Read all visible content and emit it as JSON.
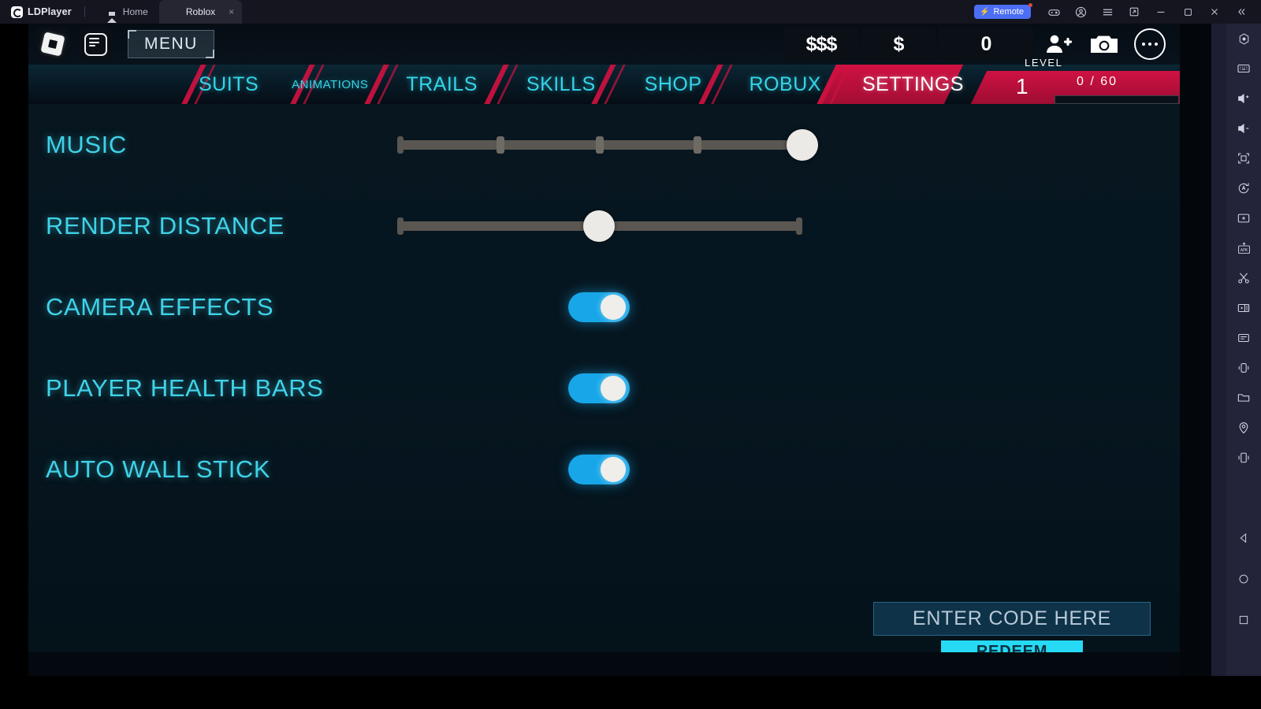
{
  "titlebar": {
    "app_name": "LDPlayer",
    "tabs": [
      {
        "label": "Home",
        "icon": "home-icon",
        "active": false
      },
      {
        "label": "Roblox",
        "icon": "roblox-icon",
        "active": true,
        "close": "×"
      }
    ],
    "remote_label": "Remote",
    "buttons": [
      {
        "name": "gamepad-icon"
      },
      {
        "name": "account-icon"
      },
      {
        "name": "hamburger-menu-icon"
      },
      {
        "name": "restore-down-icon"
      },
      {
        "name": "minimize-icon"
      },
      {
        "name": "maximize-icon"
      },
      {
        "name": "close-icon"
      },
      {
        "name": "collapse-icon"
      }
    ]
  },
  "hud": {
    "menu_label": "MENU",
    "currencies": [
      {
        "name": "premium-currency",
        "value": "$$$"
      },
      {
        "name": "cash-currency",
        "value": "$"
      },
      {
        "name": "coin-count",
        "value": "0"
      }
    ],
    "icons": [
      {
        "name": "add-friend-icon"
      },
      {
        "name": "camera-icon"
      },
      {
        "name": "more-options-icon"
      }
    ]
  },
  "nav": {
    "items": [
      {
        "label": "SUITS",
        "active": false,
        "small": false
      },
      {
        "label": "ANIMATIONS",
        "active": false,
        "small": true
      },
      {
        "label": "TRAILS",
        "active": false,
        "small": false
      },
      {
        "label": "SKILLS",
        "active": false,
        "small": false
      },
      {
        "label": "SHOP",
        "active": false,
        "small": false
      },
      {
        "label": "ROBUX",
        "active": false,
        "small": false
      },
      {
        "label": "SETTINGS",
        "active": true,
        "small": false
      }
    ]
  },
  "level": {
    "label": "LEVEL",
    "value": "1",
    "xp": "0 / 60",
    "xp_current": 0,
    "xp_max": 60
  },
  "settings": {
    "rows": [
      {
        "label": "MUSIC",
        "type": "slider",
        "value": 100,
        "ticks": [
          25,
          50,
          75
        ]
      },
      {
        "label": "RENDER DISTANCE",
        "type": "slider",
        "value": 50,
        "ticks": []
      },
      {
        "label": "CAMERA EFFECTS",
        "type": "toggle",
        "on": true
      },
      {
        "label": "PLAYER HEALTH BARS",
        "type": "toggle",
        "on": true
      },
      {
        "label": "AUTO WALL STICK",
        "type": "toggle",
        "on": true
      }
    ]
  },
  "code": {
    "input_value": "ENTER CODE HERE",
    "input_placeholder": "ENTER CODE HERE",
    "redeem_label": "REDEEM"
  },
  "rail": {
    "top_icons": [
      {
        "name": "settings-hex-icon"
      },
      {
        "name": "keyboard-icon"
      },
      {
        "name": "volume-up-icon"
      },
      {
        "name": "volume-down-icon"
      },
      {
        "name": "fullscreen-icon"
      },
      {
        "name": "auto-rotate-icon"
      },
      {
        "name": "multi-instance-icon"
      },
      {
        "name": "apk-install-icon"
      },
      {
        "name": "scissors-screenshot-icon"
      },
      {
        "name": "video-record-icon"
      },
      {
        "name": "macro-script-icon"
      },
      {
        "name": "shake-icon"
      },
      {
        "name": "shared-folder-icon"
      },
      {
        "name": "location-icon"
      },
      {
        "name": "virtual-device-icon"
      }
    ],
    "bottom_icons": [
      {
        "name": "android-back-icon"
      },
      {
        "name": "android-home-icon"
      },
      {
        "name": "android-recents-icon"
      }
    ]
  },
  "colors": {
    "accent_cyan": "#3fd2e8",
    "toggle_on": "#17a6e8",
    "crimson": "#cf1243",
    "redeem": "#26d9f5",
    "remote_blue": "#4b6ef5"
  }
}
